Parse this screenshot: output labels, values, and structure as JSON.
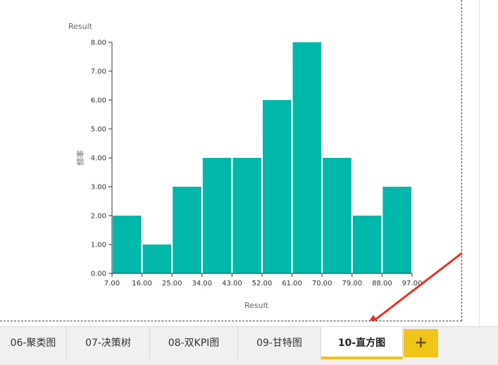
{
  "chart_data": {
    "type": "bar",
    "title": "Result",
    "xlabel": "Result",
    "ylabel": "频率",
    "x_ticks": [
      "7.00",
      "16.00",
      "25.00",
      "34.00",
      "43.00",
      "52.00",
      "61.00",
      "70.00",
      "79.00",
      "88.00",
      "97.00"
    ],
    "y_ticks": [
      "0.00",
      "1.00",
      "2.00",
      "3.00",
      "4.00",
      "5.00",
      "6.00",
      "7.00",
      "8.00"
    ],
    "bins": [
      [
        7,
        16
      ],
      [
        16,
        25
      ],
      [
        25,
        34
      ],
      [
        34,
        43
      ],
      [
        43,
        52
      ],
      [
        52,
        61
      ],
      [
        61,
        70
      ],
      [
        70,
        79
      ],
      [
        79,
        88
      ],
      [
        88,
        97
      ]
    ],
    "values": [
      2,
      1,
      3,
      4,
      4,
      6,
      8,
      4,
      2,
      3
    ],
    "xlim": [
      7,
      97
    ],
    "ylim": [
      0,
      8
    ],
    "bar_color": "#00b8a9",
    "grid": false
  },
  "tabs": [
    {
      "label": "06-聚类图",
      "active": false
    },
    {
      "label": "07-决策树",
      "active": false
    },
    {
      "label": "08-双KPI图",
      "active": false
    },
    {
      "label": "09-甘特图",
      "active": false
    },
    {
      "label": "10-直方图",
      "active": true
    }
  ],
  "add_tab_icon": "plus-icon",
  "annotation_color": "#e8302a",
  "accent_color": "#f0c419"
}
